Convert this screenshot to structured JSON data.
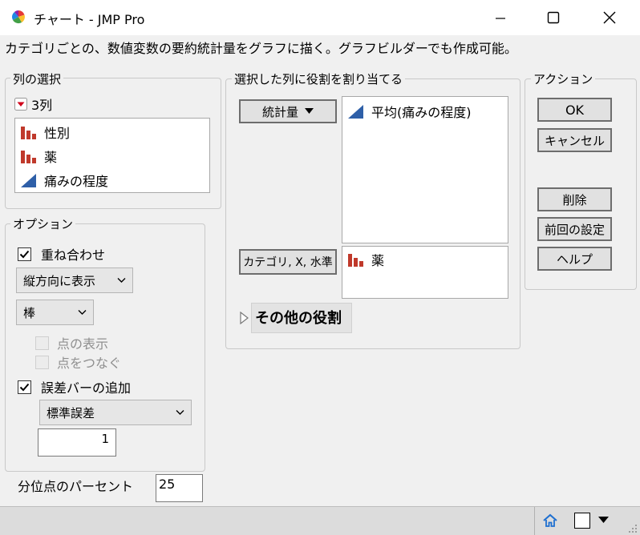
{
  "window": {
    "title": "チャート - JMP Pro"
  },
  "description": "カテゴリごとの、数値変数の要約統計量をグラフに描く。グラフビルダーでも作成可能。",
  "column_select": {
    "legend": "列の選択",
    "count_label": "3列",
    "columns": [
      {
        "label": "性別",
        "icon": "nominal-bar-icon"
      },
      {
        "label": "薬",
        "icon": "nominal-bar-icon"
      },
      {
        "label": "痛みの程度",
        "icon": "continuous-triangle-icon"
      }
    ]
  },
  "roles": {
    "legend": "選択した列に役割を割り当てる",
    "statistic_button": "統計量",
    "statistic_items": [
      "平均(痛みの程度)"
    ],
    "category_button": "カテゴリ, X, 水準",
    "category_items": [
      "薬"
    ],
    "other_roles": "その他の役割"
  },
  "actions": {
    "legend": "アクション",
    "ok": "OK",
    "cancel": "キャンセル",
    "remove": "削除",
    "recall": "前回の設定",
    "help": "ヘルプ"
  },
  "options": {
    "legend": "オプション",
    "overlay_label": "重ね合わせ",
    "overlay_checked": true,
    "orientation_value": "縦方向に表示",
    "chart_type_value": "棒",
    "show_points_label": "点の表示",
    "connect_points_label": "点をつなぐ",
    "error_bars_label": "誤差バーの追加",
    "error_bars_checked": true,
    "error_type_value": "標準誤差",
    "error_multiplier": "1"
  },
  "quantile": {
    "label": "分位点のパーセント",
    "value": "25"
  },
  "colors": {
    "nominal_red": "#c0392b",
    "continuous_blue": "#2e5fa8"
  }
}
